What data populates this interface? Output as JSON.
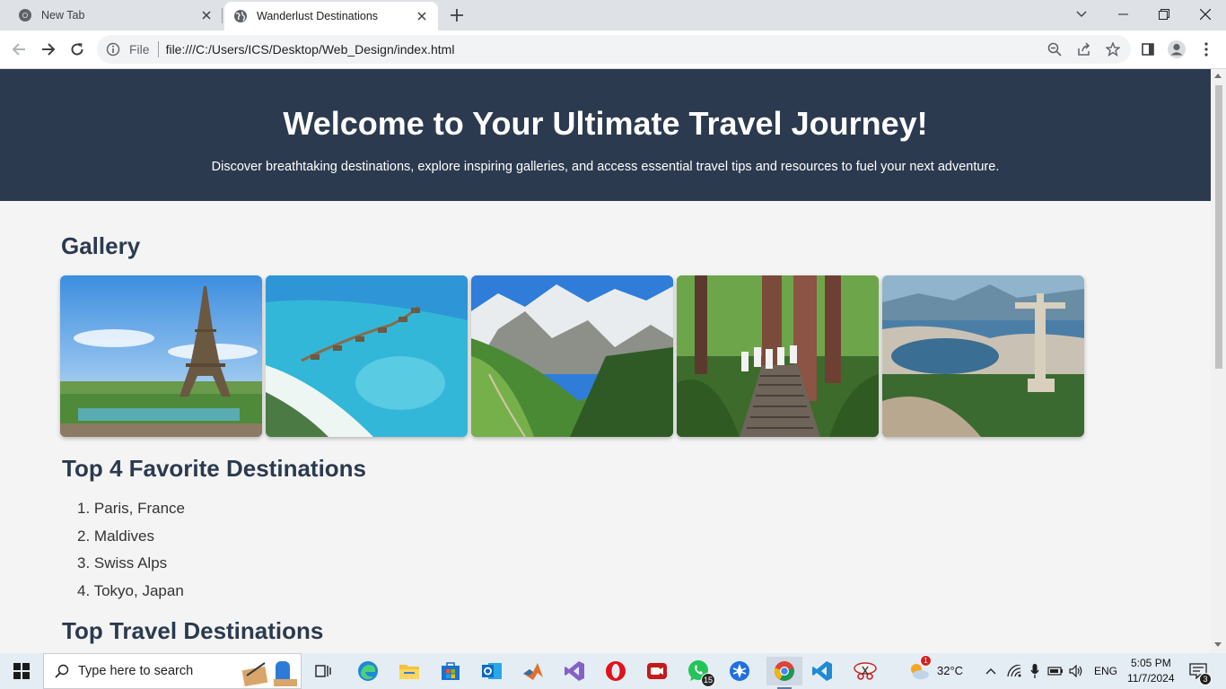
{
  "browser": {
    "tabs": [
      {
        "label": "New Tab",
        "icon": "chrome-icon",
        "active": false
      },
      {
        "label": "Wanderlust Destinations",
        "icon": "globe-icon",
        "active": true
      }
    ],
    "address": {
      "scheme": "File",
      "url": "file:///C:/Users/ICS/Desktop/Web_Design/index.html"
    }
  },
  "page": {
    "hero": {
      "title": "Welcome to Your Ultimate Travel Journey!",
      "subtitle": "Discover breathtaking destinations, explore inspiring galleries, and access essential travel tips and resources to fuel your next adventure."
    },
    "gallery": {
      "title": "Gallery",
      "photos": [
        "eiffel-tower-photo",
        "maldives-overwater-villas-photo",
        "swiss-alps-valley-photo",
        "forest-stairway-hikers-photo",
        "christ-the-redeemer-rio-photo"
      ]
    },
    "favorites": {
      "title": "Top 4 Favorite Destinations",
      "items": [
        "Paris, France",
        "Maldives",
        "Swiss Alps",
        "Tokyo, Japan"
      ]
    },
    "top_travel": {
      "title": "Top Travel Destinations"
    }
  },
  "taskbar": {
    "search_placeholder": "Type here to search",
    "whatsapp_badge": "15",
    "weather": "32°C",
    "weather_badge": "1",
    "language": "ENG",
    "time": "5:05 PM",
    "date": "11/7/2024",
    "notifications": "3"
  },
  "colors": {
    "hero_bg": "#2c3a4f",
    "heading": "#2c3a4f",
    "page_bg": "#f4f4f4"
  }
}
